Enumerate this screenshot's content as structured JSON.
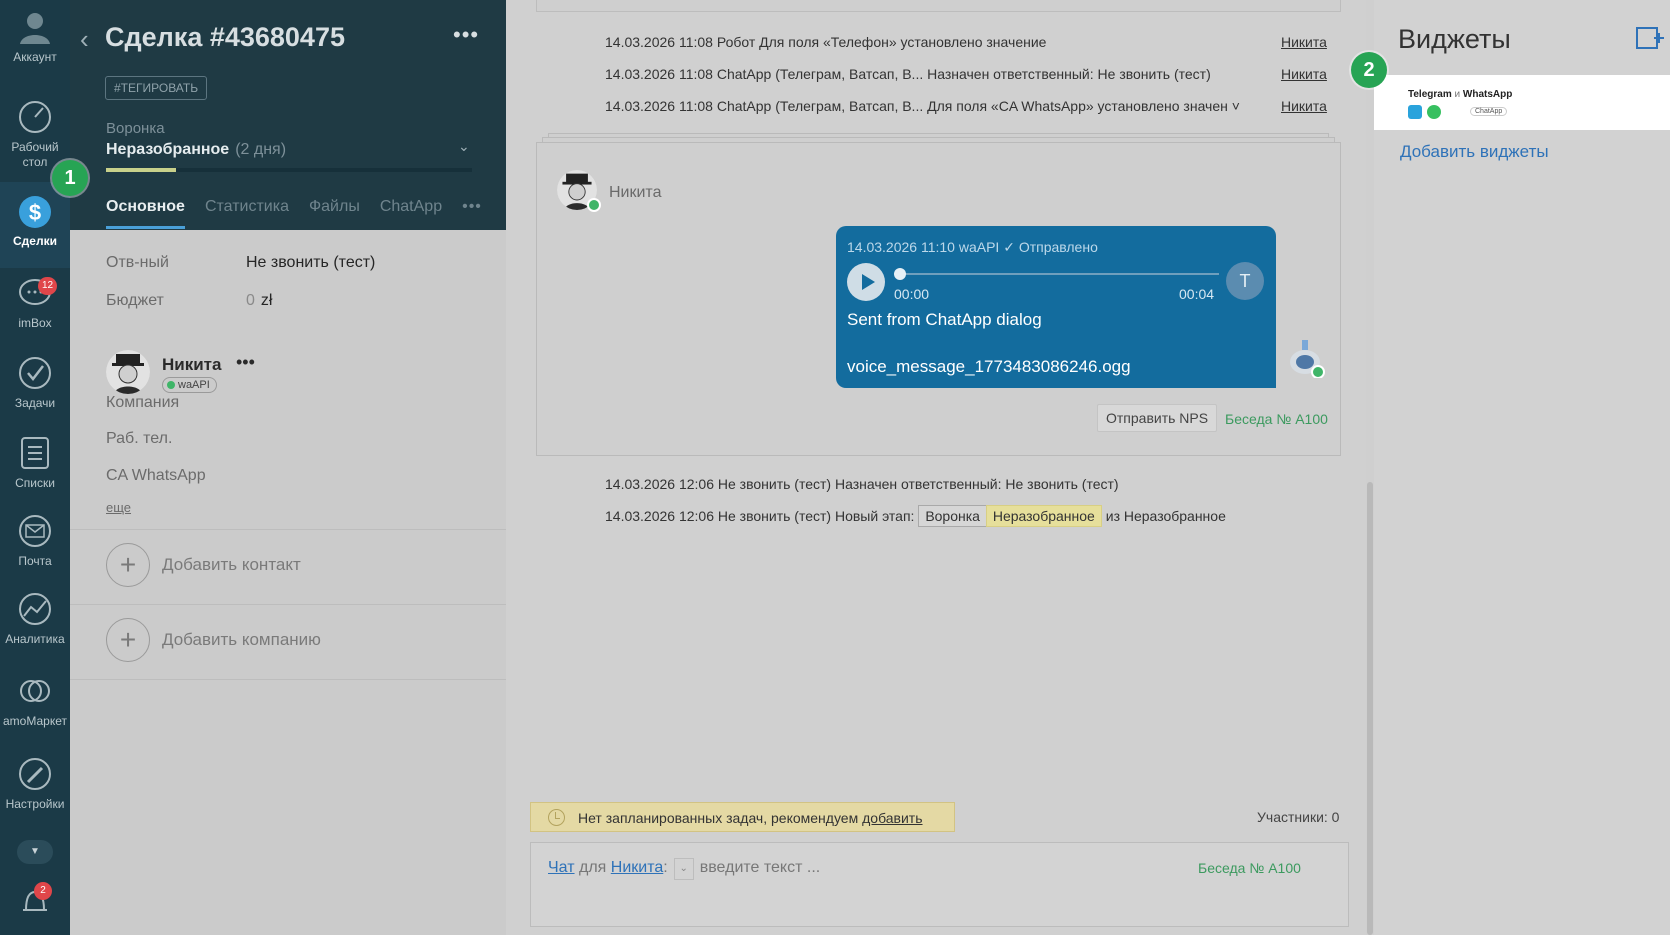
{
  "nav": {
    "items": [
      {
        "label": "Аккаунт",
        "icon": "account-icon"
      },
      {
        "label": "Рабочий стол",
        "icon": "dashboard-icon"
      },
      {
        "label": "Сделки",
        "icon": "deals-icon",
        "active": true
      },
      {
        "label": "imBox",
        "icon": "chat-icon",
        "badge": "12"
      },
      {
        "label": "Задачи",
        "icon": "tasks-icon"
      },
      {
        "label": "Списки",
        "icon": "lists-icon"
      },
      {
        "label": "Почта",
        "icon": "mail-icon"
      },
      {
        "label": "Аналитика",
        "icon": "analytics-icon"
      },
      {
        "label": "amoМаркет",
        "icon": "market-icon"
      },
      {
        "label": "Настройки",
        "icon": "settings-icon"
      }
    ],
    "notifications_badge": "2"
  },
  "lead": {
    "title": "Сделка #43680475",
    "tag_button": "#ТЕГИРОВАТЬ",
    "funnel_label": "Воронка",
    "stage": "Неразобранное",
    "stage_duration": "(2 дня)",
    "stage_progress": 0.19,
    "tabs": [
      "Основное",
      "Статистика",
      "Файлы",
      "ChatApp"
    ],
    "fields": {
      "responsible_label": "Отв-ный",
      "responsible_value": "Не звонить (тест)",
      "budget_label": "Бюджет",
      "budget_value": "0",
      "budget_currency": "zł"
    },
    "contact": {
      "name": "Никита",
      "source": "waAPI",
      "fields": [
        "Компания",
        "Раб. тел.",
        "CA WhatsApp"
      ],
      "more": "еще"
    },
    "add_contact": "Добавить контакт",
    "add_company": "Добавить компанию"
  },
  "feed": {
    "events_top": [
      {
        "text": "14.03.2026 11:08 Робот Для поля «Телефон» установлено значение",
        "user": "Никита"
      },
      {
        "text": "14.03.2026 11:08 ChatApp (Телеграм, Ватсап, В...  Назначен ответственный: Не звонить (тест)",
        "user": "Никита"
      },
      {
        "text": "14.03.2026 11:08 ChatApp (Телеграм, Ватсап, В...  Для поля «CA WhatsApp» установлено значен ˅",
        "user": "Никита"
      }
    ],
    "chat": {
      "author": "Никита",
      "meta": "14.03.2026 11:10 waAPI ✓ Отправлено",
      "time_start": "00:00",
      "time_end": "00:04",
      "avatar_letter": "T",
      "text": "Sent from ChatApp dialog",
      "file": "voice_message_1773483086246.ogg",
      "nps_button": "Отправить NPS",
      "conversation": "Беседа № A100"
    },
    "event_responsible": "14.03.2026 12:06 Не звонить (тест) Назначен ответственный: Не звонить (тест)",
    "event_stage_prefix": "14.03.2026 12:06 Не звонить (тест) Новый этап:",
    "event_stage_funnel": "Воронка",
    "event_stage_name": "Неразобранное",
    "event_stage_suffix": "из Неразобранное",
    "tasks_notice": "Нет запланированных задач, рекомендуем ",
    "tasks_notice_link": "добавить",
    "participants": "Участники: 0",
    "composer": {
      "mode": "Чат",
      "for": "для",
      "recipient": "Никита",
      "placeholder": "введите текст ...",
      "conversation": "Беседа № A100"
    }
  },
  "widgets": {
    "title": "Виджеты",
    "widget_name": "Telegram",
    "widget_and": "и",
    "widget_name2": "WhatsApp",
    "widget_brand": "ChatApp",
    "add_link": "Добавить виджеты"
  },
  "markers": [
    "1",
    "2"
  ],
  "colors": {
    "nav_bg": "#1b3a47",
    "header_bg": "#1f3a44",
    "message_bubble": "#136c9e",
    "marker": "#27a454",
    "link": "#2e72b8",
    "conversation_link": "#3c9a5f",
    "stage_highlight": "#e6df9b"
  }
}
